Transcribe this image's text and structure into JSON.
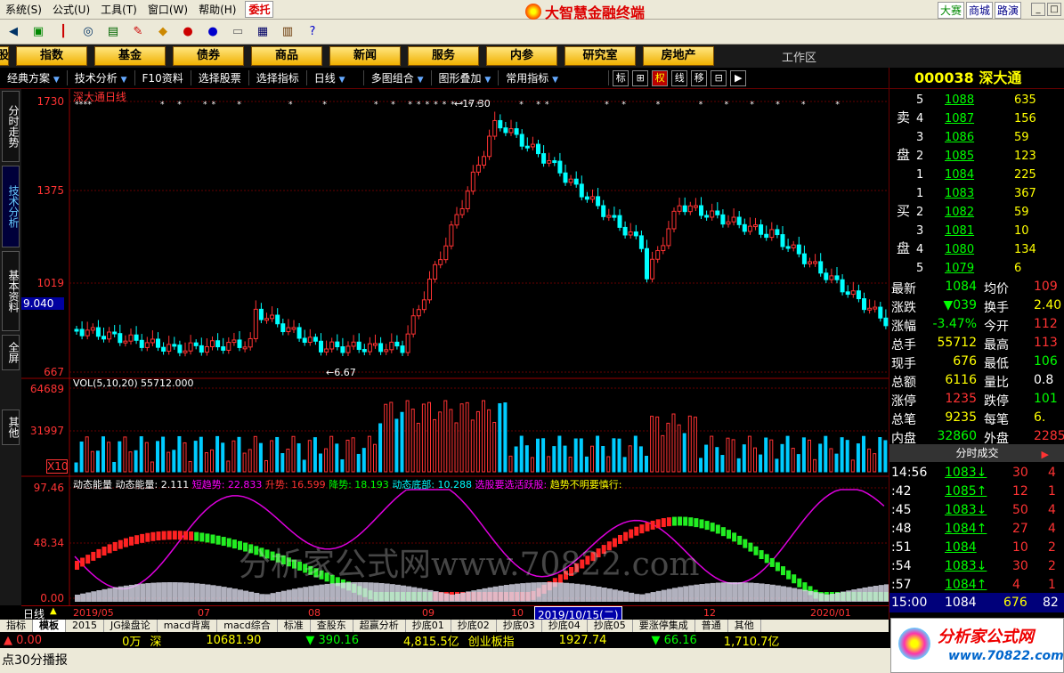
{
  "menu": {
    "items": [
      "系统(S)",
      "公式(U)",
      "工具(T)",
      "窗口(W)",
      "帮助(H)"
    ],
    "order_label": "委托",
    "app_title": "大智慧金融终端",
    "right_tabs": [
      "大赛",
      "商城",
      "路演"
    ]
  },
  "nav": {
    "buttons": [
      "股",
      "指数",
      "基金",
      "债券",
      "商品",
      "新闻",
      "服务",
      "内参",
      "研究室",
      "房地产"
    ],
    "workzone": "工作区"
  },
  "subbar": {
    "items": [
      "经典方案",
      "技术分析",
      "F10资料",
      "选择股票",
      "选择指标",
      "日线",
      "多图组合",
      "图形叠加",
      "常用指标"
    ],
    "icons": [
      "标",
      "⊞",
      "权",
      "线",
      "移",
      "⊟",
      "▶"
    ]
  },
  "vtabs": [
    "分时走势",
    "技术分析",
    "基本资料",
    "全屏",
    "其他"
  ],
  "chart": {
    "title": "深大通日线",
    "price_labels": [
      "1730",
      "1375",
      "1019",
      "667"
    ],
    "cursor_value": "9.040",
    "high_note": "17.30",
    "low_note": "6.67",
    "vol_title": "VOL(5,10,20)",
    "vol_value": "55712.000",
    "vol_labels": [
      "64689",
      "31997",
      "X10"
    ],
    "ind_title": "动态能量",
    "ind_params": [
      "动态能量: 2.111",
      "短趋势: 22.833",
      "升势: 16.599",
      "降势: 18.193",
      "动态底部: 10.288",
      "选股要选活跃股:",
      "趋势不明要慎行:"
    ],
    "ind_labels": [
      "97.46",
      "48.34",
      "0.00"
    ],
    "period_label": "日线",
    "x_labels": [
      "2019/05",
      "07",
      "08",
      "09",
      "10",
      "12",
      "2020/01"
    ],
    "x_highlight": "2019/10/15(二)",
    "watermark": "分析家公式网www.70822.com"
  },
  "quote": {
    "code": "000038",
    "name": "深大通",
    "asks": [
      {
        "lv": "5",
        "p": "1088",
        "v": "635"
      },
      {
        "lv": "4",
        "p": "1087",
        "v": "156"
      },
      {
        "lv": "3",
        "p": "1086",
        "v": "59"
      },
      {
        "lv": "2",
        "p": "1085",
        "v": "123"
      },
      {
        "lv": "1",
        "p": "1084",
        "v": "225"
      }
    ],
    "bids": [
      {
        "lv": "1",
        "p": "1083",
        "v": "367"
      },
      {
        "lv": "2",
        "p": "1082",
        "v": "59"
      },
      {
        "lv": "3",
        "p": "1081",
        "v": "10"
      },
      {
        "lv": "4",
        "p": "1080",
        "v": "134"
      },
      {
        "lv": "5",
        "p": "1079",
        "v": "6"
      }
    ],
    "sell_label": [
      "卖",
      "盘"
    ],
    "buy_label": [
      "买",
      "盘"
    ],
    "stats": [
      [
        "最新",
        "1084",
        "均价",
        "109"
      ],
      [
        "涨跌",
        "▼039",
        "换手",
        "2.40"
      ],
      [
        "涨幅",
        "-3.47%",
        "今开",
        "112"
      ],
      [
        "总手",
        "55712",
        "最高",
        "113"
      ],
      [
        "现手",
        "676",
        "最低",
        "106"
      ],
      [
        "总额",
        "6116",
        "量比",
        "0.8"
      ],
      [
        "涨停",
        "1235",
        "跌停",
        "101"
      ],
      [
        "总笔",
        "9235",
        "每笔",
        "6."
      ],
      [
        "内盘",
        "32860",
        "外盘",
        "2285"
      ]
    ],
    "trades_title": "分时成交",
    "trades": [
      [
        "14:56",
        "1083↓",
        "30",
        "4"
      ],
      [
        ":42",
        "1085↑",
        "12",
        "1"
      ],
      [
        ":45",
        "1083↓",
        "50",
        "4"
      ],
      [
        ":48",
        "1084↑",
        "27",
        "4"
      ],
      [
        ":51",
        "1084",
        "10",
        "2"
      ],
      [
        ":54",
        "1083↓",
        "30",
        "2"
      ],
      [
        ":57",
        "1084↑",
        "4",
        "1"
      ]
    ],
    "last": [
      "15:00",
      "1084",
      "676",
      "82"
    ]
  },
  "bottom_tabs": [
    "指标",
    "模板",
    "2015",
    "JG操盘论",
    "macd背离",
    "macd综合",
    "标准",
    "查股东",
    "超赢分析",
    "抄底01",
    "抄底02",
    "抄底03",
    "抄底04",
    "抄底05",
    "要涨停集成",
    "普通",
    "其他"
  ],
  "index_bar": [
    "▲ 0.00",
    "0万",
    "深",
    "10681.90",
    "▼ 390.16",
    "4,815.5亿",
    "创业板指",
    "1927.74",
    "▼ 66.16",
    "1,710.7亿"
  ],
  "status": "点30分播报",
  "brand": {
    "name": "分析家公式网",
    "url": "www.70822.com"
  }
}
